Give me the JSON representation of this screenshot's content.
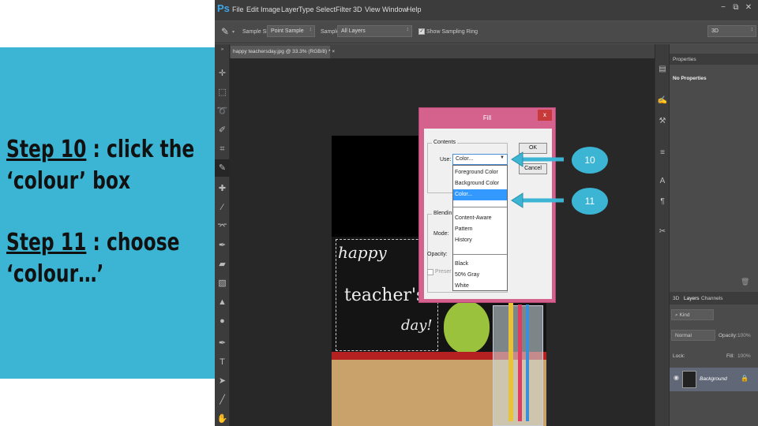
{
  "slide": {
    "step10": {
      "prefix": "Step 10",
      "text": " : click the",
      "line2": "‘colour’ box"
    },
    "step11": {
      "prefix": "Step 11",
      "text": " : choose",
      "line2": "‘colour…’"
    }
  },
  "photoshop": {
    "logo": "Ps",
    "menus": [
      "File",
      "Edit",
      "Image",
      "Layer",
      "Type",
      "Select",
      "Filter",
      "3D",
      "View",
      "Window",
      "Help"
    ],
    "window_controls": {
      "minimize": "−",
      "restore": "⧉",
      "close": "✕"
    },
    "options_bar": {
      "sample_size_label": "Sample Size:",
      "sample_size_value": "Point Sample",
      "sample_label": "Sample:",
      "sample_value": "All Layers",
      "show_ring_label": "Show Sampling Ring",
      "workspace_value": "3D"
    },
    "document_tab": "happy teachersday.jpg @ 33.3% (RGB/8) *",
    "image_text": {
      "line1": "happy",
      "line2": "teacher's",
      "line3": "day!"
    },
    "properties_panel": {
      "tab": "Properties",
      "message": "No Properties"
    },
    "layers_panel": {
      "tabs": [
        "3D",
        "Layers",
        "Channels"
      ],
      "kind_label": "Kind",
      "blend_mode": "Normal",
      "opacity_label": "Opacity:",
      "opacity_value": "100%",
      "lock_label": "Lock:",
      "fill_label": "Fill:",
      "fill_value": "100%",
      "layer_name": "Background"
    }
  },
  "fill_dialog": {
    "title": "Fill",
    "close_label": "x",
    "contents_label": "Contents",
    "use_label": "Use:",
    "use_value": "Color...",
    "ok_label": "OK",
    "cancel_label": "Cancel",
    "blending_label": "Blendin",
    "mode_label": "Mode:",
    "opacity_label": "Opacity:",
    "preserve_label": "Preser",
    "options": [
      {
        "label": "Foreground Color",
        "selected": false
      },
      {
        "label": "Background Color",
        "selected": false
      },
      {
        "label": "Color...",
        "selected": true
      },
      {
        "label": "Content-Aware",
        "selected": false
      },
      {
        "label": "Pattern",
        "selected": false
      },
      {
        "label": "History",
        "selected": false
      },
      {
        "label": "Black",
        "selected": false
      },
      {
        "label": "50% Gray",
        "selected": false
      },
      {
        "label": "White",
        "selected": false
      }
    ]
  },
  "callouts": {
    "first": "10",
    "second": "11"
  },
  "colors": {
    "slide_accent": "#3bb5d3",
    "dialog_frame": "#d4628d",
    "selection": "#3399ff"
  }
}
